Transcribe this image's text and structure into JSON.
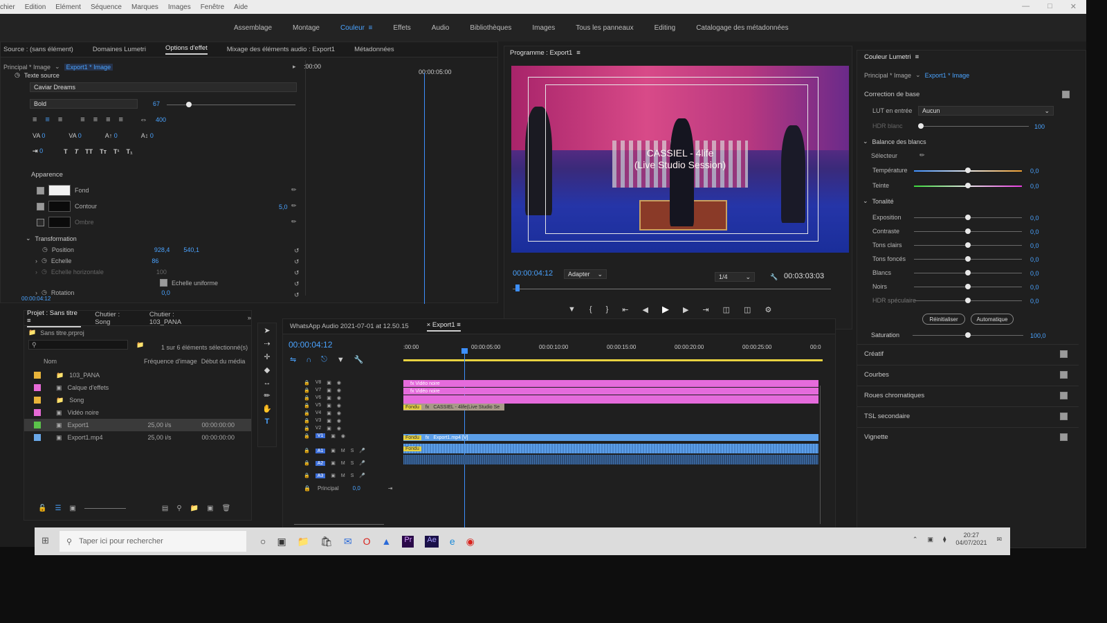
{
  "menu": [
    "chier",
    "Edition",
    "Elément",
    "Séquence",
    "Marques",
    "Images",
    "Fenêtre",
    "Aide"
  ],
  "workspaces": [
    "Assemblage",
    "Montage",
    "Couleur",
    "Effets",
    "Audio",
    "Bibliothèques",
    "Images",
    "Tous les panneaux",
    "Editing",
    "Catalogage des métadonnées"
  ],
  "source_panel": {
    "tabs": [
      "Source : (sans élément)",
      "Domaines Lumetri",
      "Options d'effet",
      "Mixage des éléments audio : Export1",
      "Métadonnées"
    ],
    "clip_left": "Principal * Image",
    "clip_right": "Export1 * Image",
    "time_start": ":00:00",
    "time_mark": "00:00:05:00",
    "source_text": "Texte source",
    "font": "Caviar Dreams",
    "style": "Bold",
    "size": "67",
    "tracking_val": "400",
    "zero": "0",
    "appearance": "Apparence",
    "fill": "Fond",
    "stroke": "Contour",
    "stroke_width": "5,0",
    "shadow": "Ombre",
    "transform": "Transformation",
    "position": "Position",
    "pos_x": "928,4",
    "pos_y": "540,1",
    "scale": "Echelle",
    "scale_val": "86",
    "scale_h": "Echelle horizontale",
    "scale_h_val": "100",
    "uniform": "Echelle uniforme",
    "rotation": "Rotation",
    "rotation_val": "0,0",
    "timecode": "00:00:04:12"
  },
  "program": {
    "title": "Programme : Export1",
    "overlay_line1": "CASSIEL - 4life",
    "overlay_line2": "(Live Studio Session)",
    "timecode": "00:00:04:12",
    "fit": "Adapter",
    "quality": "1/4",
    "duration": "00:03:03:03"
  },
  "project": {
    "tabs": [
      "Projet : Sans titre",
      "Chutier : Song",
      "Chutier : 103_PANA"
    ],
    "file": "Sans titre.prproj",
    "selection": "1 sur 6 éléments sélectionné(s)",
    "col_name": "Nom",
    "col_rate": "Fréquence d'image",
    "col_start": "Début du média",
    "items": [
      {
        "name": "103_PANA",
        "rate": "",
        "start": "",
        "color": "#e8b43a"
      },
      {
        "name": "Calque d'effets",
        "rate": "",
        "start": "",
        "color": "#e66ad6"
      },
      {
        "name": "Song",
        "rate": "",
        "start": "",
        "color": "#e8b43a"
      },
      {
        "name": "Vidéo noire",
        "rate": "",
        "start": "",
        "color": "#e66ad6"
      },
      {
        "name": "Export1",
        "rate": "25,00 i/s",
        "start": "00:00:00:00",
        "color": "#5bc24a"
      },
      {
        "name": "Export1.mp4",
        "rate": "25,00 i/s",
        "start": "00:00:00:00",
        "color": "#6aa8e8"
      }
    ]
  },
  "timeline": {
    "tab_inactive": "WhatsApp Audio 2021-07-01 at 12.50.15",
    "tab_active": "Export1",
    "timecode": "00:00:04:12",
    "ruler": [
      ":00:00",
      "00:00:05:00",
      "00:00:10:00",
      "00:00:15:00",
      "00:00:20:00",
      "00:00:25:00",
      "00:0"
    ],
    "video_tracks": [
      "V8",
      "V7",
      "V6",
      "V5",
      "V4",
      "V3",
      "V2",
      "V1"
    ],
    "audio_tracks": [
      "A1",
      "A2",
      "A3"
    ],
    "master": "Principal",
    "master_val": "0,0",
    "clip_video1": "Vidéo noire",
    "clip_video2": "Vidéo noire",
    "clip_text": "CASSIEL - 4life(Live Studio Se",
    "clip_fx_label": "Fondu",
    "clip_main": "Export1.mp4 [V]",
    "clip_main_label": "Fondu",
    "clip_audio_label": "Fondu",
    "track_buttons": [
      "M",
      "S"
    ]
  },
  "lumetri": {
    "title": "Couleur Lumetri",
    "clip_left": "Principal * Image",
    "clip_right": "Export1 * Image",
    "basic": "Correction de base",
    "lut": "LUT en entrée",
    "lut_val": "Aucun",
    "hdr": "HDR blanc",
    "hdr_val": "100",
    "wb": "Balance des blancs",
    "selector": "Sélecteur",
    "temp": "Température",
    "tint": "Teinte",
    "tone": "Tonalité",
    "exposure": "Exposition",
    "contrast": "Contraste",
    "highlights": "Tons clairs",
    "shadows": "Tons foncés",
    "whites": "Blancs",
    "blacks": "Noirs",
    "hdr_spec": "HDR spéculaire",
    "zero": "0,0",
    "reset": "Réinitialiser",
    "auto": "Automatique",
    "saturation": "Saturation",
    "sat_val": "100,0",
    "sections": [
      "Créatif",
      "Courbes",
      "Roues chromatiques",
      "TSL secondaire",
      "Vignette"
    ]
  },
  "taskbar": {
    "search": "Taper ici pour rechercher",
    "time": "20:27",
    "date": "04/07/2021"
  }
}
